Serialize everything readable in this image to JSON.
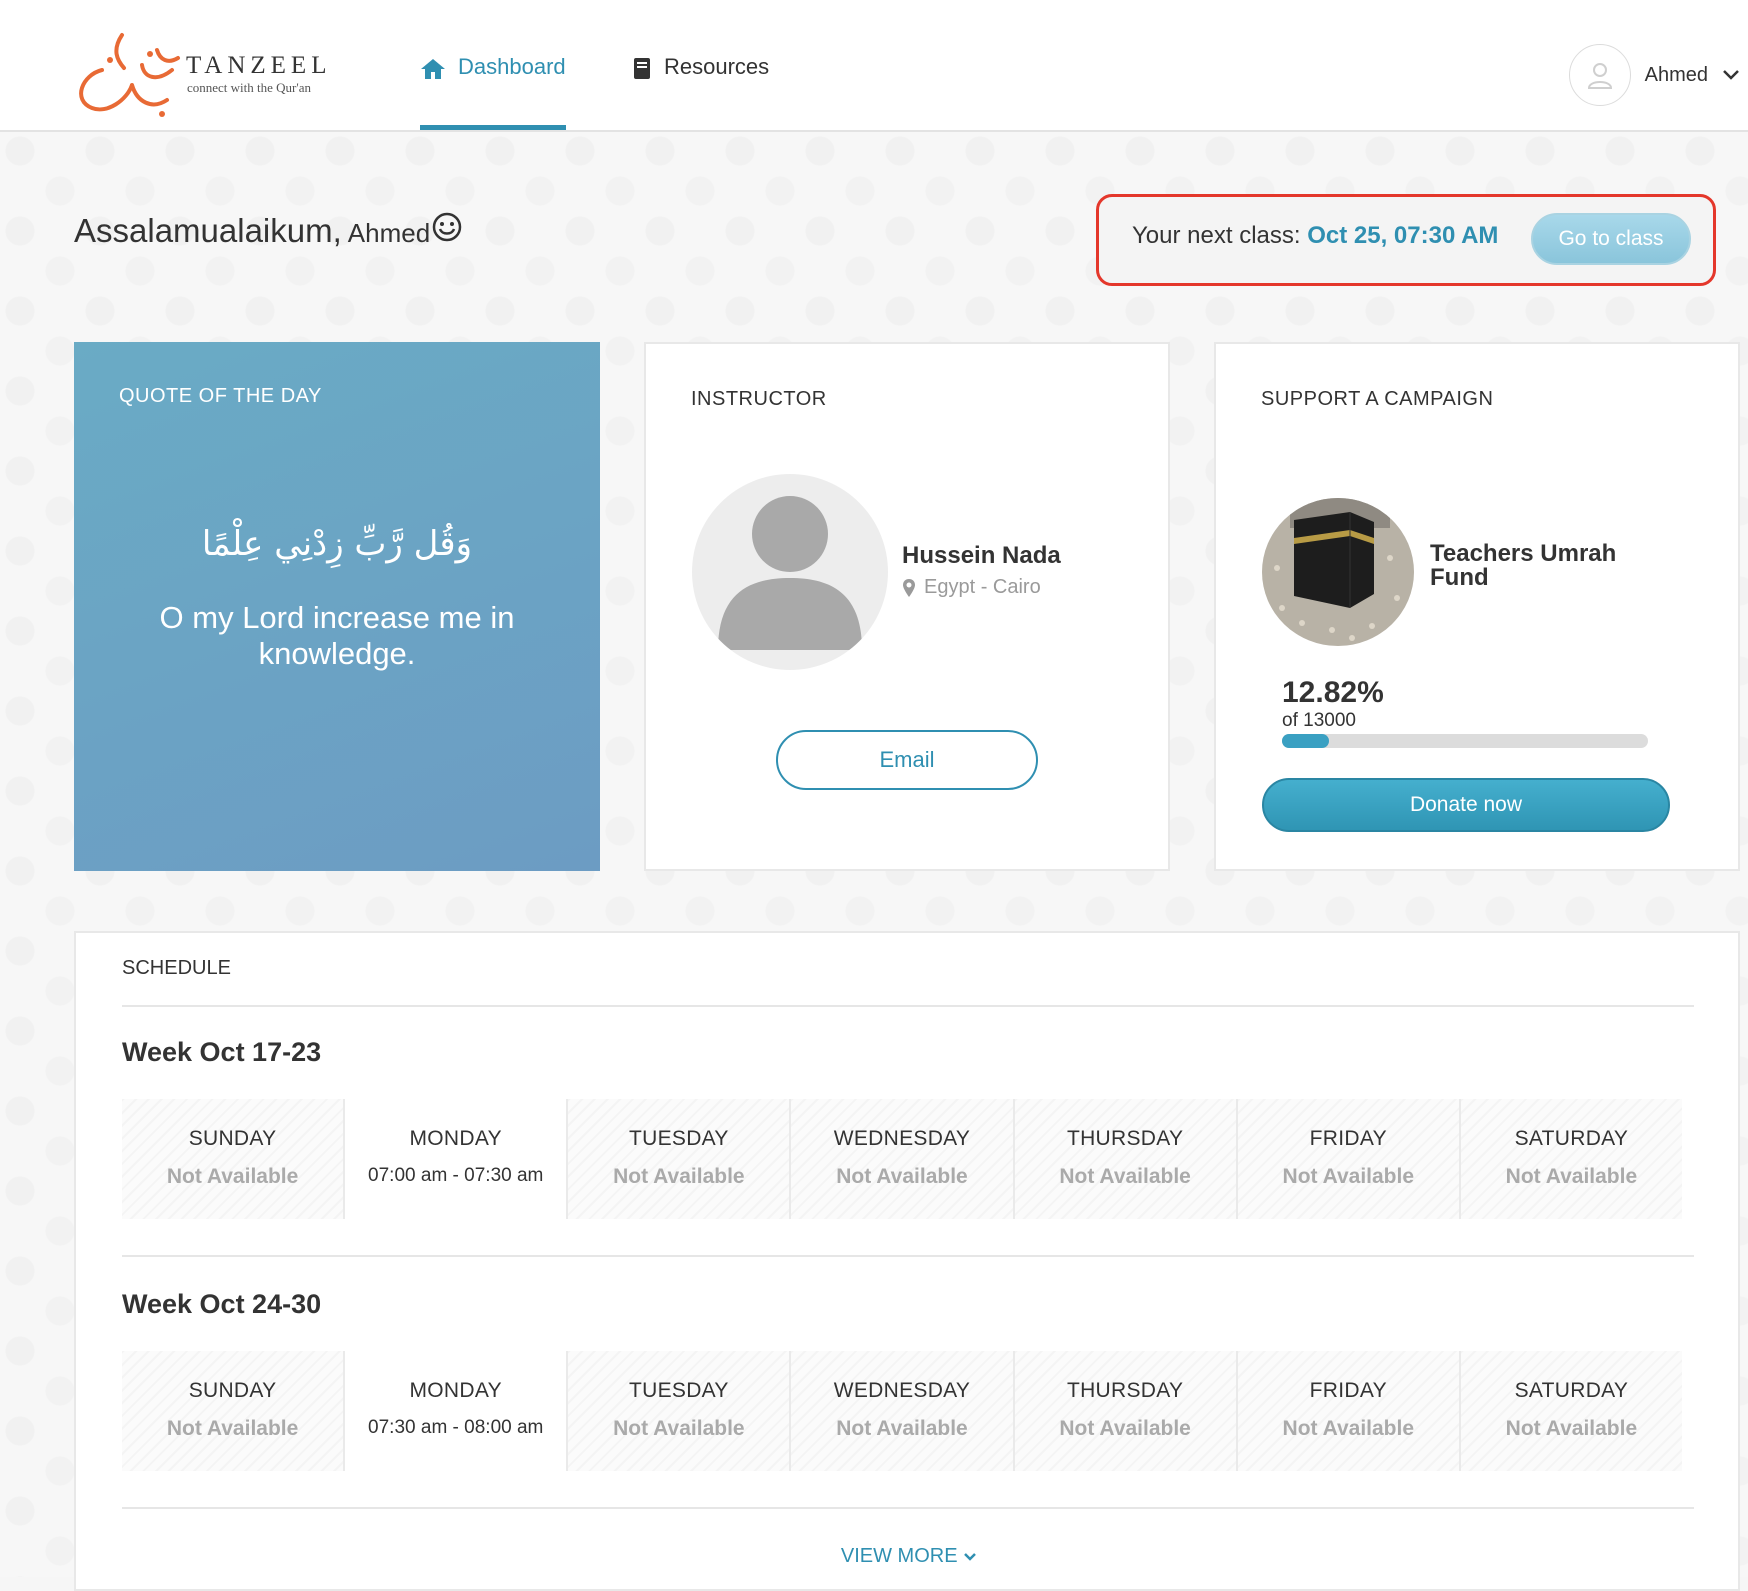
{
  "brand": {
    "name": "TANZEEL",
    "tagline": "connect with the Qur'an",
    "logo_arabic": "تنزيل",
    "accent": "#2f8fb1",
    "logo_color": "#e86a35"
  },
  "nav": [
    {
      "label": "Dashboard",
      "icon": "home-icon",
      "active": true
    },
    {
      "label": "Resources",
      "icon": "book-icon",
      "active": false
    }
  ],
  "user": {
    "name": "Ahmed"
  },
  "greeting": {
    "text": "Assalamualaikum,",
    "name": "Ahmed"
  },
  "next_class": {
    "label": "Your next class:",
    "date": "Oct 25, 07:30 AM",
    "button": "Go to class"
  },
  "quote": {
    "title": "QUOTE OF THE DAY",
    "arabic": "وَقُل رَّبِّ زِدْنِي عِلْمًا",
    "english": "O my Lord increase me in knowledge."
  },
  "instructor": {
    "title": "INSTRUCTOR",
    "name": "Hussein Nada",
    "location": "Egypt - Cairo",
    "button": "Email"
  },
  "campaign": {
    "title": "SUPPORT A CAMPAIGN",
    "name": "Teachers Umrah Fund",
    "percent": "12.82%",
    "percent_value": 0.1282,
    "goal": "of 13000",
    "button": "Donate now"
  },
  "schedule": {
    "title": "SCHEDULE",
    "weeks": [
      {
        "title": "Week Oct 17-23",
        "days": [
          {
            "day": "SUNDAY",
            "status": "Not Available",
            "available": false
          },
          {
            "day": "MONDAY",
            "status": "07:00 am  -  07:30 am",
            "available": true
          },
          {
            "day": "TUESDAY",
            "status": "Not Available",
            "available": false
          },
          {
            "day": "WEDNESDAY",
            "status": "Not Available",
            "available": false
          },
          {
            "day": "THURSDAY",
            "status": "Not Available",
            "available": false
          },
          {
            "day": "FRIDAY",
            "status": "Not Available",
            "available": false
          },
          {
            "day": "SATURDAY",
            "status": "Not Available",
            "available": false
          }
        ]
      },
      {
        "title": "Week Oct 24-30",
        "days": [
          {
            "day": "SUNDAY",
            "status": "Not Available",
            "available": false
          },
          {
            "day": "MONDAY",
            "status": "07:30 am  -  08:00 am",
            "available": true
          },
          {
            "day": "TUESDAY",
            "status": "Not Available",
            "available": false
          },
          {
            "day": "WEDNESDAY",
            "status": "Not Available",
            "available": false
          },
          {
            "day": "THURSDAY",
            "status": "Not Available",
            "available": false
          },
          {
            "day": "FRIDAY",
            "status": "Not Available",
            "available": false
          },
          {
            "day": "SATURDAY",
            "status": "Not Available",
            "available": false
          }
        ]
      }
    ],
    "view_more": "VIEW MORE"
  }
}
